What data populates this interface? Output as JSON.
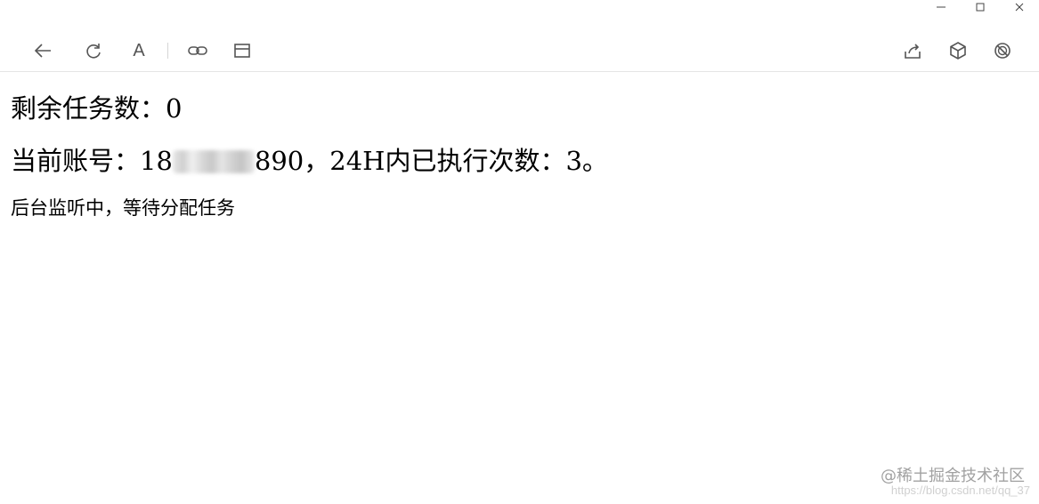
{
  "window_controls": {
    "minimize_icon": "minimize-icon",
    "maximize_icon": "maximize-icon",
    "close_icon": "close-icon"
  },
  "toolbar": {
    "left_icons": [
      "back-arrow-icon",
      "refresh-icon",
      "font-icon",
      "link-icon",
      "window-icon"
    ],
    "font_glyph": "A",
    "right_icons": [
      "share-icon",
      "cube-icon",
      "block-icon"
    ]
  },
  "content": {
    "remaining_tasks": "剩余任务数：0",
    "account_prefix": "当前账号：18",
    "account_suffix": "890，24H内已执行次数：3。",
    "status": "后台监听中，等待分配任务"
  },
  "watermark": {
    "brand": "@稀土掘金技术社区",
    "url": "https://blog.csdn.net/qq_37"
  },
  "colors": {
    "icon": "#555555",
    "text": "#000000",
    "divider": "#e5e5e5"
  }
}
